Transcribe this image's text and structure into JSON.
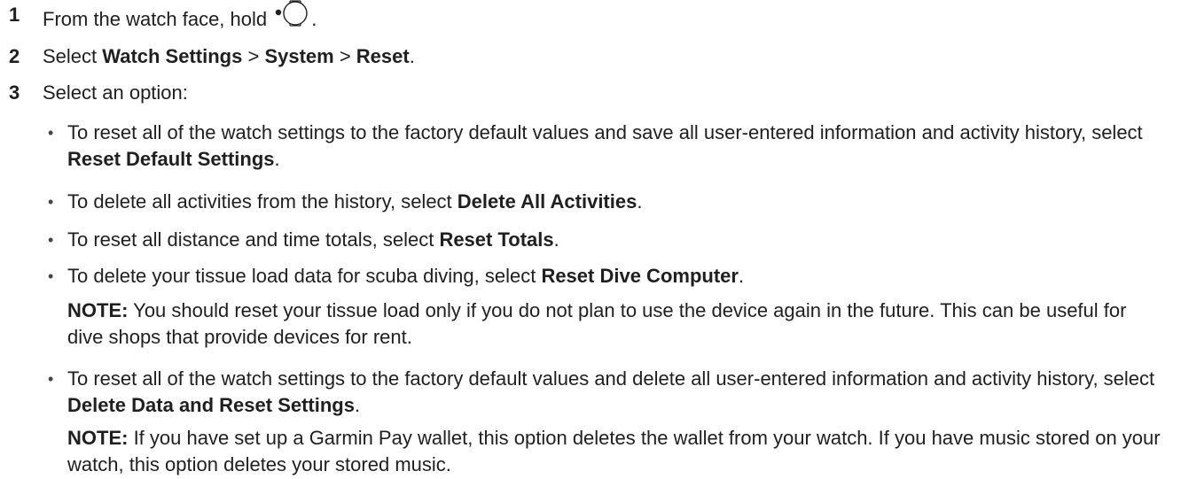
{
  "steps": [
    {
      "number": "1",
      "text": "From the watch face, hold",
      "suffix": "."
    },
    {
      "number": "2",
      "prefix": "Select ",
      "menu1": "Watch Settings",
      "sep1": " > ",
      "menu2": "System",
      "sep2": " > ",
      "menu3": "Reset",
      "suffix": "."
    },
    {
      "number": "3",
      "text": "Select an option:"
    }
  ],
  "options": [
    {
      "text": "To reset all of the watch settings to the factory default values and save all user-entered information and activity history, select ",
      "bold": "Reset Default Settings",
      "end": "."
    },
    {
      "text": "To delete all activities from the history, select ",
      "bold": "Delete All Activities",
      "end": "."
    },
    {
      "text": "To reset all distance and time totals, select ",
      "bold": "Reset Totals",
      "end": "."
    },
    {
      "text": "To delete your tissue load data for scuba diving, select ",
      "bold": "Reset Dive Computer",
      "end": ".",
      "note_label": "NOTE:",
      "note_text": " You should reset your tissue load only if you do not plan to use the device again in the future. This can be useful for dive shops that provide devices for rent."
    },
    {
      "text": "To reset all of the watch settings to the factory default values and delete all user-entered information and activity history, select ",
      "bold": "Delete Data and Reset Settings",
      "end": ".",
      "note_label": "NOTE:",
      "note_text": " If you have set up a Garmin Pay wallet, this option deletes the wallet from your watch. If you have music stored on your watch, this option deletes your stored music."
    }
  ],
  "bullet_char": "•",
  "icons": {
    "button": "watch-button-icon"
  }
}
